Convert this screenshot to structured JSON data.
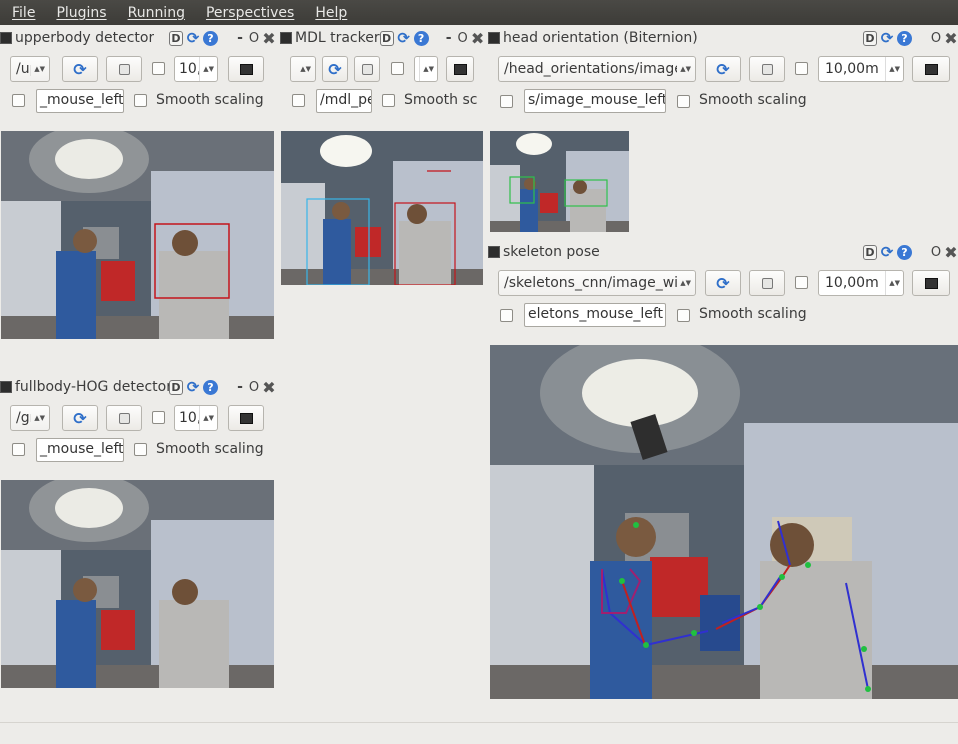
{
  "menu": [
    "File",
    "Plugins",
    "Running",
    "Perspectives",
    "Help"
  ],
  "panels": {
    "upperbody": {
      "title": "upperbody detector",
      "topic": "/up",
      "spin_value": "10,",
      "text_value": "_mouse_left",
      "smooth_label": "Smooth scaling"
    },
    "mdl": {
      "title": "MDL tracker",
      "topic": "",
      "spin_value": "",
      "text_value": "/mdl_pe",
      "smooth_label": "Smooth sc"
    },
    "head": {
      "title": "head orientation (Biternion)",
      "topic": "/head_orientations/image",
      "spin_value": "10,00m",
      "text_value": "s/image_mouse_left",
      "smooth_label": "Smooth scaling"
    },
    "skeleton": {
      "title": "skeleton pose",
      "topic": "/skeletons_cnn/image_wit",
      "spin_value": "10,00m",
      "text_value": "eletons_mouse_left",
      "smooth_label": "Smooth scaling"
    },
    "hog": {
      "title": "fullbody-HOG detector",
      "topic": "/gr",
      "spin_value": "10,",
      "text_value": "_mouse_left",
      "smooth_label": "Smooth scaling"
    }
  },
  "icons": {
    "dock": "D",
    "reload": "⟳",
    "help": "?",
    "minimize": "-",
    "float": "O",
    "close": "✖",
    "refresh": "⟳"
  },
  "colors": {
    "upperbody_box": "#c4141b",
    "mdl_box_left": "#38b6e8",
    "mdl_box_right": "#c4141b",
    "head_box_left": "#2fc04a",
    "head_box_right": "#2fc04a",
    "skeleton_left": "#3030d0",
    "skeleton_right": "#c02020",
    "skeleton_joint": "#20c040"
  }
}
